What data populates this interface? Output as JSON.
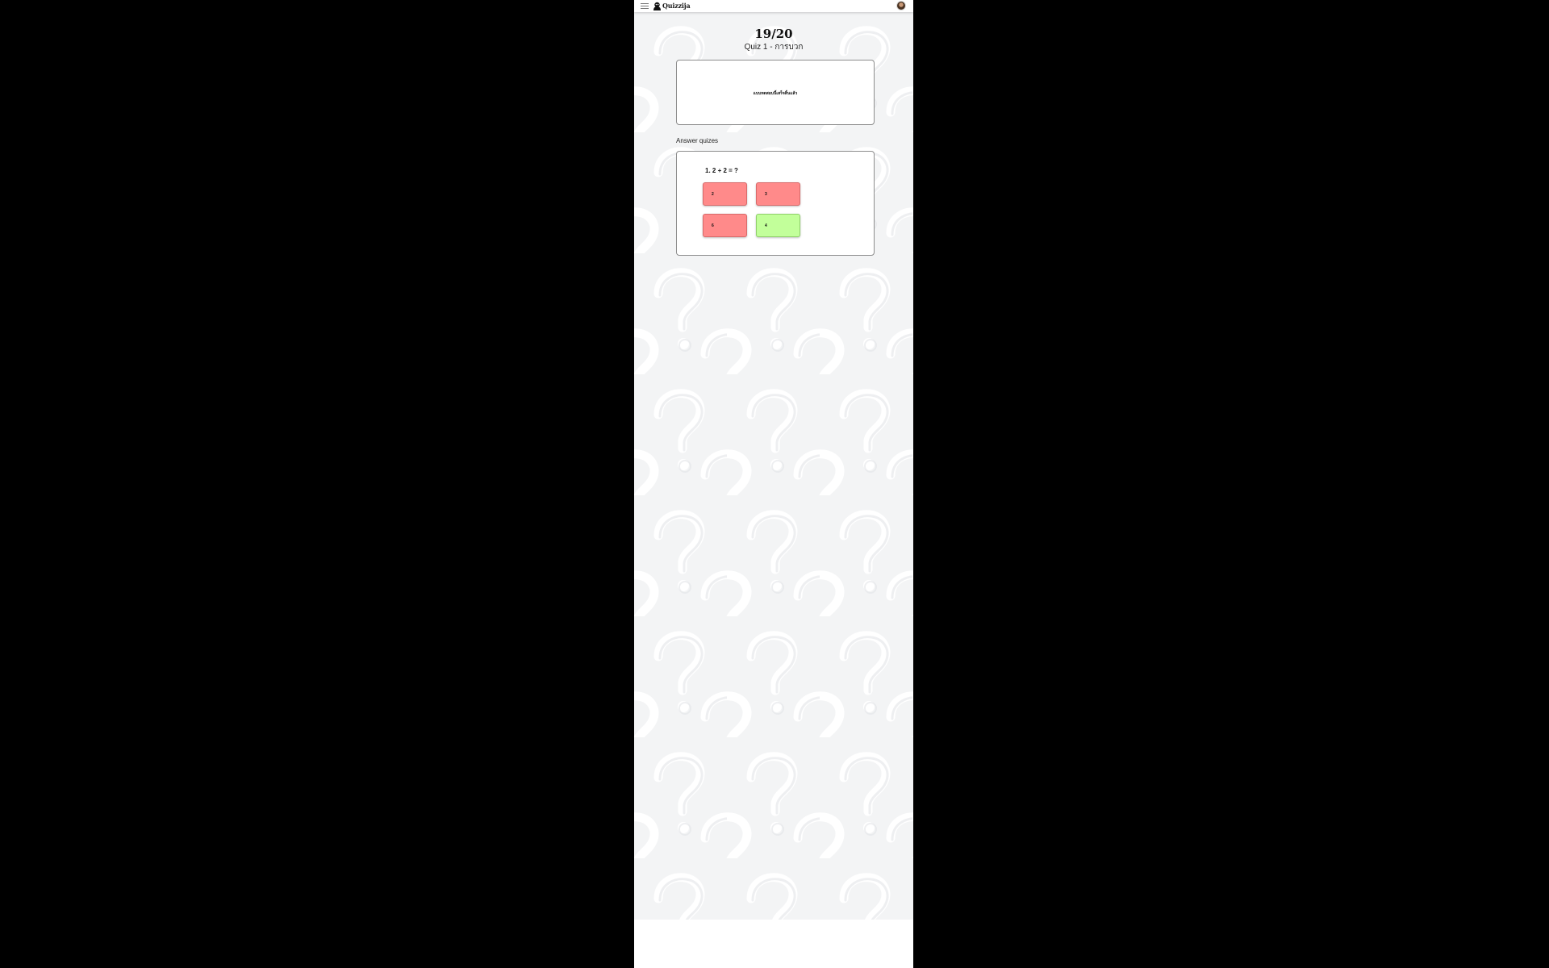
{
  "navbar": {
    "app_name": "Quizzija",
    "menu_icon": "hamburger-icon",
    "logo_icon": "mascot-icon",
    "avatar_icon": "user-avatar"
  },
  "result": {
    "score": "19/20",
    "quiz_title": "Quiz 1 - การบวก",
    "message": "แบบทดสอบนี้เสร็จสิ้นแล้ว"
  },
  "answers": {
    "section_label": "Answer quizes",
    "question": "1. 2 + 2 = ?",
    "choices": [
      {
        "label": "2",
        "status": "wrong"
      },
      {
        "label": "3",
        "status": "wrong"
      },
      {
        "label": "6",
        "status": "wrong"
      },
      {
        "label": "4",
        "status": "correct"
      }
    ]
  },
  "colors": {
    "wrong": "#ff8a8a",
    "correct": "#c2ff9a",
    "background": "#f3f4f5",
    "letterbox": "#000000"
  }
}
